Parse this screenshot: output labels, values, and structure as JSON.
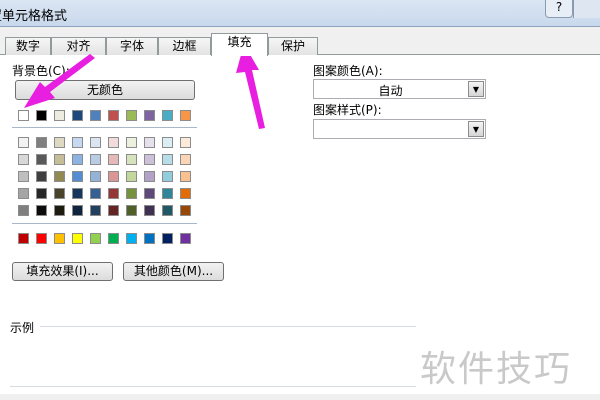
{
  "window": {
    "title": "设置单元格格式",
    "help_label": "?"
  },
  "tabs": [
    {
      "label": "数字"
    },
    {
      "label": "对齐"
    },
    {
      "label": "字体"
    },
    {
      "label": "边框"
    },
    {
      "label": "填充",
      "active": true
    },
    {
      "label": "保护"
    }
  ],
  "fill": {
    "background_label": "背景色(C):",
    "no_color_label": "无颜色",
    "theme_row": [
      "#ffffff",
      "#000000",
      "#eeece1",
      "#1f497d",
      "#4f81bd",
      "#c0504d",
      "#9bbb59",
      "#8064a2",
      "#4bacc6",
      "#f79646"
    ],
    "tint_rows": [
      [
        "#f2f2f2",
        "#7f7f7f",
        "#ddd9c3",
        "#c6d9f0",
        "#dbe5f1",
        "#f2dcdb",
        "#ebf1dd",
        "#e5e0ec",
        "#dbeef3",
        "#fdeada"
      ],
      [
        "#d8d8d8",
        "#595959",
        "#c4bd97",
        "#8db3e2",
        "#b8cce4",
        "#e5b9b7",
        "#d7e3bc",
        "#ccc1d9",
        "#b7dde8",
        "#fbd5b5"
      ],
      [
        "#bfbfbf",
        "#3f3f3f",
        "#938953",
        "#548dd4",
        "#95b3d7",
        "#d99694",
        "#c3d69b",
        "#b2a2c7",
        "#92cddc",
        "#fac08f"
      ],
      [
        "#a5a5a5",
        "#262626",
        "#494429",
        "#17365d",
        "#366092",
        "#953734",
        "#76923c",
        "#5f497a",
        "#31859b",
        "#e36c09"
      ],
      [
        "#7f7f7f",
        "#0c0c0c",
        "#1d1b10",
        "#0f243e",
        "#244061",
        "#632423",
        "#4f6128",
        "#3f3151",
        "#205867",
        "#974806"
      ]
    ],
    "standard_row": [
      "#c00000",
      "#ff0000",
      "#ffc000",
      "#ffff00",
      "#92d050",
      "#00b050",
      "#00b0f0",
      "#0070c0",
      "#002060",
      "#7030a0"
    ],
    "fill_effects_label": "填充效果(I)...",
    "more_colors_label": "其他颜色(M)...",
    "pattern_color_label": "图案颜色(A):",
    "pattern_color_value": "自动",
    "pattern_style_label": "图案样式(P):",
    "pattern_style_value": "",
    "sample_label": "示例"
  },
  "watermark": "软件技巧",
  "annotation_color": "#e81ee0"
}
